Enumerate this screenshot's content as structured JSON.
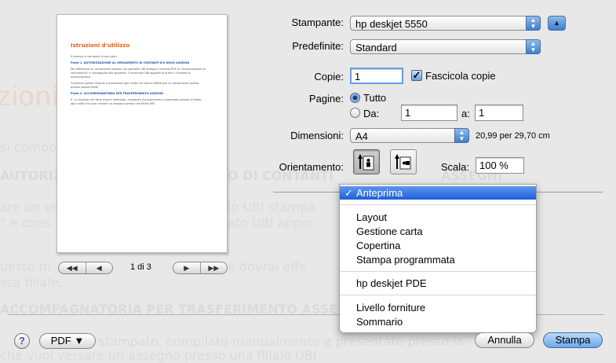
{
  "preview": {
    "title": "Istruzioni d'utilizzo",
    "intro": "Il modulo si compone di due parti.",
    "part1_heading": "Parte 1. AUTORIZZAZIONE AL VERSAMENTO DI CONTANTI E/O INVIO ASSEGNI",
    "part1_body": [
      "Per effettuare un versamento presso uno sportello UBI stampa il modulo PDF di \"Autorizzazione al",
      "versamento\" e consegnalo allo sportello. L'incaricato UBI apporrà la firma e il timbro di",
      "autorizzazione."
    ],
    "part1_body2": [
      "Conserva questo modulo e presentalo ogni volta che dovrai effettuare un versamento presso",
      "questa stessa filiale."
    ],
    "part2_heading": "Parte 2. ACCOMPAGNATORIA PER TRASFERIMENTO ASSEGNI",
    "part2_body": [
      "E' un modulo che deve essere stampato, compilato manualmente e presentato presso la filiale,",
      "ogni volta che vuoi versare un assegno presso una filiale UBI."
    ],
    "page_indicator": "1 di 3",
    "nav_first": "◀◀",
    "nav_prev": "◀",
    "nav_next": "▶",
    "nav_last": "▶▶"
  },
  "background": {
    "title_fragment": "zioni d",
    "line_compo": "si compo",
    "line_autorizz": "AUTORIZ",
    "line_contanti": "O DI CONTANTI",
    "line_assegni": "ASSEGNI",
    "line_versare": "are un ve",
    "line_ubistampa": "lo UBI stampa",
    "line_econs": "\" e cons",
    "line_ubiappor": "ato UBI appor",
    "line_questo": "uesto m",
    "line_dovrai": "e dovrai effe",
    "line_filiale": "ssa filiale.",
    "line_accomp": "ACCOMPAGNATORIA PER TRASFERIMENTO ASSE",
    "line_stampato": "ssere stampato, compilato manualmente e presentato presso la",
    "line_vuoi": "che vuoi versare un assegno presso una filiale UBI."
  },
  "form": {
    "printer_label": "Stampante:",
    "printer_value": "hp deskjet 5550",
    "expand_icon": "▲",
    "presets_label": "Predefinite:",
    "presets_value": "Standard",
    "copies_label": "Copie:",
    "copies_value": "1",
    "collate_label": "Fascicola copie",
    "collate_checked": true,
    "pages_label": "Pagine:",
    "pages_all": "Tutto",
    "pages_from": "Da:",
    "pages_from_value": "1",
    "pages_to": "a:",
    "pages_to_value": "1",
    "size_label": "Dimensioni:",
    "size_value": "A4",
    "size_dims": "20,99 per 29,70 cm",
    "orientation_label": "Orientamento:",
    "scale_label": "Scala:",
    "scale_value": "100 %"
  },
  "menu": {
    "items": [
      {
        "label": "Anteprima",
        "checked": true,
        "highlighted": true
      },
      {
        "label": "Layout"
      },
      {
        "label": "Gestione carta"
      },
      {
        "label": "Copertina"
      },
      {
        "label": "Stampa programmata"
      },
      {
        "label": "hp deskjet PDE"
      },
      {
        "label": "Livello forniture"
      },
      {
        "label": "Sommario"
      }
    ],
    "check_mark": "✓"
  },
  "buttons": {
    "help": "?",
    "pdf": "PDF ▼",
    "cancel": "Annulla",
    "print": "Stampa"
  },
  "colors": {
    "highlight": "#2a6ae0",
    "default_button": "#6ea8ea",
    "preview_title": "#e8601a"
  }
}
